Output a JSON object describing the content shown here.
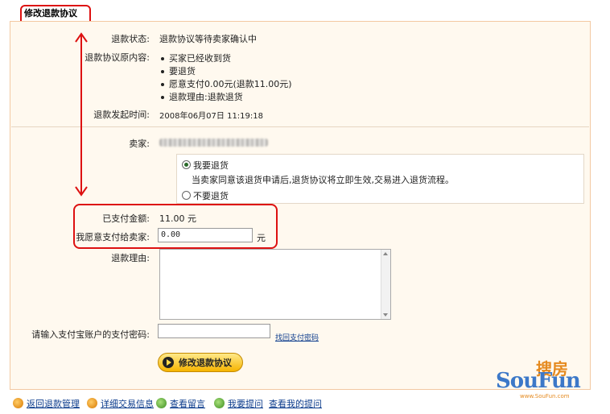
{
  "title": "修改退款协议",
  "info": {
    "status_label": "退款状态:",
    "status_value": "退款协议等待卖家确认中",
    "original_label": "退款协议原内容:",
    "original_items": [
      "买家已经收到货",
      "要退货",
      "愿意支付0.00元(退款11.00元)",
      "退款理由:退款退货"
    ],
    "time_label": "退款发起时间:",
    "time_value": "2008年06月07日 11:19:18"
  },
  "seller": {
    "label": "卖家:"
  },
  "return_options": {
    "option1": "我要退货",
    "option1_desc": "当卖家同意该退货申请后,退货协议将立即生效,交易进入退货流程。",
    "option2": "不要退货",
    "selected": "option1"
  },
  "paid": {
    "label": "已支付金额:",
    "value": "11.00 元"
  },
  "willing": {
    "label": "我愿意支付给卖家:",
    "value": "0.00",
    "unit": "元"
  },
  "reason": {
    "label": "退款理由:"
  },
  "password": {
    "label": "请输入支付宝账户的支付密码:",
    "retrieve_link": "找回支付密码"
  },
  "submit_button": "修改退款协议",
  "footer": {
    "back": "返回退款管理",
    "detail": "详细交易信息",
    "view_msg": "查看留言",
    "ask": "我要提问",
    "view_questions": "查看我的提问"
  },
  "watermark": {
    "brand_cn": "搜房",
    "brand_en": "SouFun",
    "url": "www.SouFun.com"
  },
  "colors": {
    "highlight": "#dd1111",
    "panel_bg": "#fff9ef",
    "link": "#0b3b8c",
    "button": "#f6b400"
  }
}
